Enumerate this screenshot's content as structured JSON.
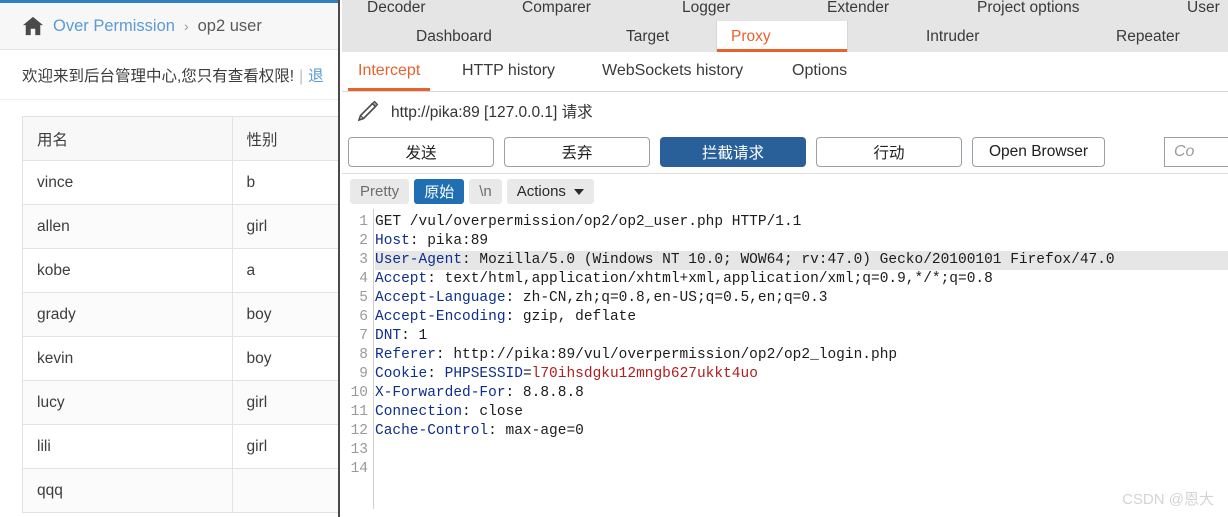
{
  "page": {
    "breadcrumb": {
      "home_icon": "home-icon",
      "root_label": "Over Permission",
      "separator": "›",
      "current_label": "op2 user"
    },
    "welcome": {
      "message": "欢迎来到后台管理中心,您只有查看权限!",
      "separator": "|",
      "logout_label": "退"
    },
    "table": {
      "headers": [
        "用名",
        "性别"
      ],
      "rows": [
        [
          "vince",
          "b"
        ],
        [
          "allen",
          "girl"
        ],
        [
          "kobe",
          "a"
        ],
        [
          "grady",
          "boy"
        ],
        [
          "kevin",
          "boy"
        ],
        [
          "lucy",
          "girl"
        ],
        [
          "lili",
          "girl"
        ],
        [
          "qqq",
          ""
        ]
      ]
    }
  },
  "burp": {
    "menu_top": [
      "Decoder",
      "Comparer",
      "Logger",
      "Extender",
      "Project options",
      "User"
    ],
    "menu_bottom": [
      {
        "label": "Dashboard",
        "active": false
      },
      {
        "label": "Target",
        "active": false
      },
      {
        "label": "Proxy",
        "active": true
      },
      {
        "label": "Intruder",
        "active": false
      },
      {
        "label": "Repeater",
        "active": false
      }
    ],
    "subtabs": [
      {
        "label": "Intercept",
        "active": true
      },
      {
        "label": "HTTP history",
        "active": false
      },
      {
        "label": "WebSockets history",
        "active": false
      },
      {
        "label": "Options",
        "active": false
      }
    ],
    "request_title": {
      "icon": "pencil-icon",
      "text": "http://pika:89  [127.0.0.1] 请求"
    },
    "buttons": [
      {
        "label": "发送",
        "primary": false
      },
      {
        "label": "丢弃",
        "primary": false
      },
      {
        "label": "拦截请求",
        "primary": true
      },
      {
        "label": "行动",
        "primary": false
      },
      {
        "label": "Open Browser",
        "primary": false
      }
    ],
    "search_placeholder": "Co",
    "format_bar": {
      "pretty_label": "Pretty",
      "raw_label": "原始",
      "newline_label": "\\n",
      "actions_label": "Actions",
      "caret_icon": "chevron-down-icon"
    },
    "accent_color": "#e8622c",
    "primary_color": "#2a6099"
  },
  "request": {
    "line_count": 14,
    "lines": [
      {
        "n": 1,
        "highlight": false,
        "parts": [
          {
            "t": "GET /vul/overpermission/op2/op2_user.php HTTP/1.1",
            "c": "plain"
          }
        ]
      },
      {
        "n": 2,
        "highlight": false,
        "parts": [
          {
            "t": "Host",
            "c": "k"
          },
          {
            "t": ": pika:89",
            "c": "plain"
          }
        ]
      },
      {
        "n": 3,
        "highlight": true,
        "parts": [
          {
            "t": "User-Agent",
            "c": "k"
          },
          {
            "t": ": Mozilla/5.0 (Windows NT 10.0; WOW64; rv:47.0) Gecko/20100101 Firefox/47.0",
            "c": "plain"
          }
        ]
      },
      {
        "n": 4,
        "highlight": false,
        "parts": [
          {
            "t": "Accept",
            "c": "k"
          },
          {
            "t": ": text/html,application/xhtml+xml,application/xml;q=0.9,*/*;q=0.8",
            "c": "plain"
          }
        ]
      },
      {
        "n": 5,
        "highlight": false,
        "parts": [
          {
            "t": "Accept-Language",
            "c": "k"
          },
          {
            "t": ": zh-CN,zh;q=0.8,en-US;q=0.5,en;q=0.3",
            "c": "plain"
          }
        ]
      },
      {
        "n": 6,
        "highlight": false,
        "parts": [
          {
            "t": "Accept-Encoding",
            "c": "k"
          },
          {
            "t": ": gzip, deflate",
            "c": "plain"
          }
        ]
      },
      {
        "n": 7,
        "highlight": false,
        "parts": [
          {
            "t": "DNT",
            "c": "k"
          },
          {
            "t": ": 1",
            "c": "plain"
          }
        ]
      },
      {
        "n": 8,
        "highlight": false,
        "parts": [
          {
            "t": "Referer",
            "c": "k"
          },
          {
            "t": ": http://pika:89/vul/overpermission/op2/op2_login.php",
            "c": "plain"
          }
        ]
      },
      {
        "n": 9,
        "highlight": false,
        "parts": [
          {
            "t": "Cookie",
            "c": "k"
          },
          {
            "t": ": ",
            "c": "plain"
          },
          {
            "t": "PHPSESSID",
            "c": "k"
          },
          {
            "t": "=",
            "c": "plain"
          },
          {
            "t": "l70ihsdgku12mngb627ukkt4uo",
            "c": "red"
          }
        ]
      },
      {
        "n": 10,
        "highlight": false,
        "parts": [
          {
            "t": "X-Forwarded-For",
            "c": "k"
          },
          {
            "t": ": 8.8.8.8",
            "c": "plain"
          }
        ]
      },
      {
        "n": 11,
        "highlight": false,
        "parts": [
          {
            "t": "Connection",
            "c": "k"
          },
          {
            "t": ": close",
            "c": "plain"
          }
        ]
      },
      {
        "n": 12,
        "highlight": false,
        "parts": [
          {
            "t": "Cache-Control",
            "c": "k"
          },
          {
            "t": ": max-age=0",
            "c": "plain"
          }
        ]
      },
      {
        "n": 13,
        "highlight": false,
        "parts": []
      },
      {
        "n": 14,
        "highlight": false,
        "parts": []
      }
    ]
  },
  "watermark": {
    "text": "CSDN @恩大"
  }
}
